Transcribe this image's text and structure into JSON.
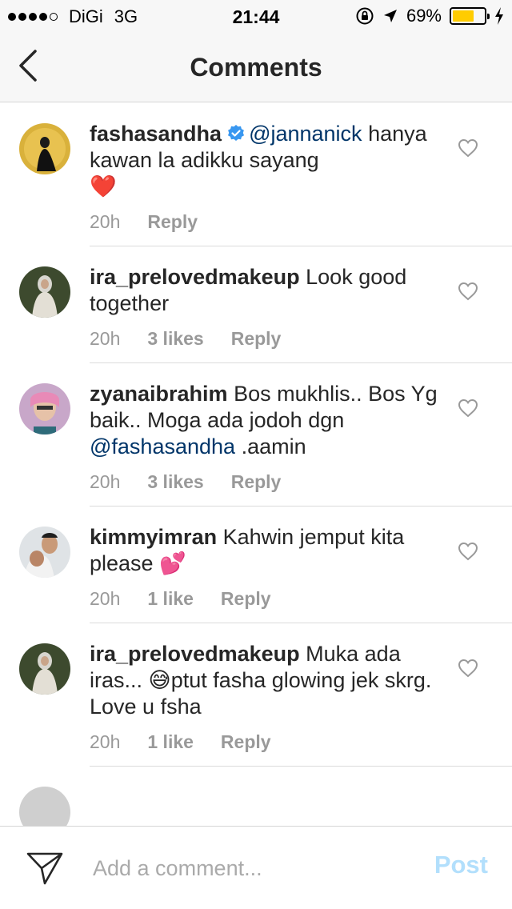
{
  "status_bar": {
    "carrier": "DiGi",
    "network": "3G",
    "time": "21:44",
    "battery": "69%",
    "battery_level": 0.69,
    "signal_bars": 4,
    "signal_total": 5
  },
  "nav": {
    "title": "Comments",
    "back_icon": "chevron-left-icon"
  },
  "comments": [
    {
      "username": "fashasandha",
      "verified": true,
      "mention": "@jannanick",
      "text": "hanya kawan la adikku sayang",
      "emoji": "❤️",
      "time": "20h",
      "likes": "",
      "reply_label": "Reply"
    },
    {
      "username": "ira_prelovedmakeup",
      "text": "Look good together",
      "time": "20h",
      "likes": "3 likes",
      "reply_label": "Reply"
    },
    {
      "username": "zyanaibrahim",
      "text": "Bos mukhlis.. Bos Yg baik.. Moga ada jodoh dgn",
      "mention": "@fashasandha",
      "text_after": ".aamin",
      "time": "20h",
      "likes": "3 likes",
      "reply_label": "Reply"
    },
    {
      "username": "kimmyimran",
      "text": "Kahwin jemput kita please",
      "emoji": "💕",
      "time": "20h",
      "likes": "1 like",
      "reply_label": "Reply"
    },
    {
      "username": "ira_prelovedmakeup",
      "text": "Muka ada iras...",
      "emoji": "😅",
      "text_after": "ptut fasha glowing jek skrg. Love u fsha",
      "time": "20h",
      "likes": "1 like",
      "reply_label": "Reply"
    }
  ],
  "composer": {
    "placeholder": "Add a comment...",
    "post_label": "Post",
    "send_icon": "paper-plane-icon"
  },
  "colors": {
    "verified_blue": "#3897f0",
    "mention_blue": "#003569",
    "meta_gray": "#999999",
    "post_disabled": "#b2dffc",
    "battery_yellow": "#ffcc00"
  }
}
